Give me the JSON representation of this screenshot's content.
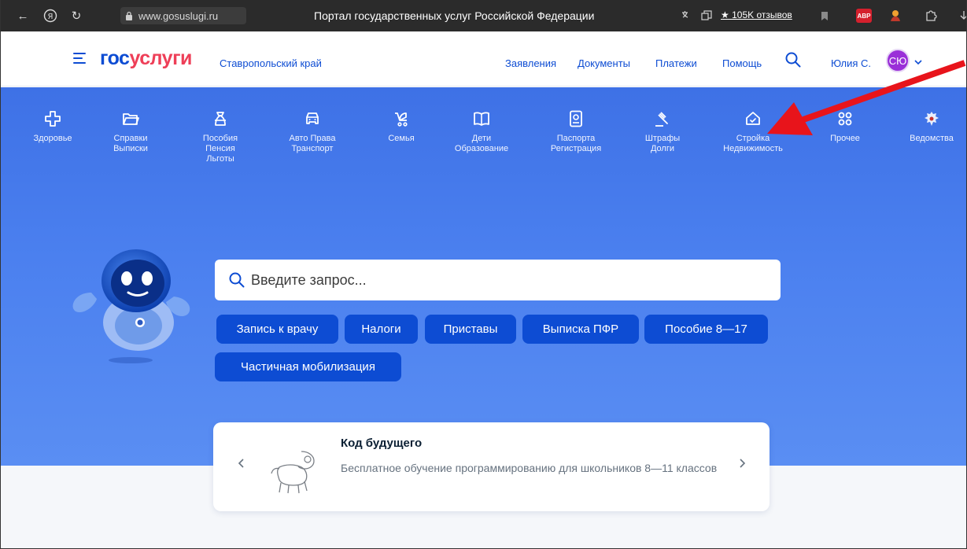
{
  "browser": {
    "url": "www.gosuslugi.ru",
    "title": "Портал государственных услуг Российской Федерации",
    "reviews": "★ 105K отзывов",
    "abp_label": "ABP"
  },
  "header": {
    "logo_part1": "гос",
    "logo_part2": "услуги",
    "region": "Ставропольский край",
    "nav": [
      "Заявления",
      "Документы",
      "Платежи",
      "Помощь"
    ],
    "user_name": "Юлия С.",
    "avatar_initials": "СЮ"
  },
  "categories": [
    {
      "icon": "health-cross-icon",
      "lines": [
        "Здоровье"
      ]
    },
    {
      "icon": "folder-icon",
      "lines": [
        "Справки",
        "Выписки"
      ]
    },
    {
      "icon": "money-bag-icon",
      "lines": [
        "Пособия",
        "Пенсия",
        "Льготы"
      ]
    },
    {
      "icon": "car-icon",
      "lines": [
        "Авто Права",
        "Транспорт"
      ]
    },
    {
      "icon": "stroller-icon",
      "lines": [
        "Семья"
      ]
    },
    {
      "icon": "book-icon",
      "lines": [
        "Дети",
        "Образование"
      ]
    },
    {
      "icon": "passport-icon",
      "lines": [
        "Паспорта",
        "Регистрация"
      ]
    },
    {
      "icon": "gavel-icon",
      "lines": [
        "Штрафы",
        "Долги"
      ]
    },
    {
      "icon": "house-icon",
      "lines": [
        "Стройка",
        "Недвижимость"
      ]
    },
    {
      "icon": "grid-icon",
      "lines": [
        "Прочее"
      ]
    },
    {
      "icon": "emblem-icon",
      "lines": [
        "Ведомства"
      ]
    }
  ],
  "search": {
    "placeholder": "Введите запрос..."
  },
  "chips": [
    "Запись к врачу",
    "Налоги",
    "Приставы",
    "Выписка ПФР",
    "Пособие 8—17",
    "Частичная мобилизация"
  ],
  "promo": {
    "title": "Код будущего",
    "text": "Бесплатное обучение программированию для школьников 8—11 классов"
  },
  "colors": {
    "brand_blue": "#0d4cd3",
    "brand_red": "#ee3f58",
    "hero_blue": "#4b80ef",
    "annotation_red": "#e8141b"
  }
}
